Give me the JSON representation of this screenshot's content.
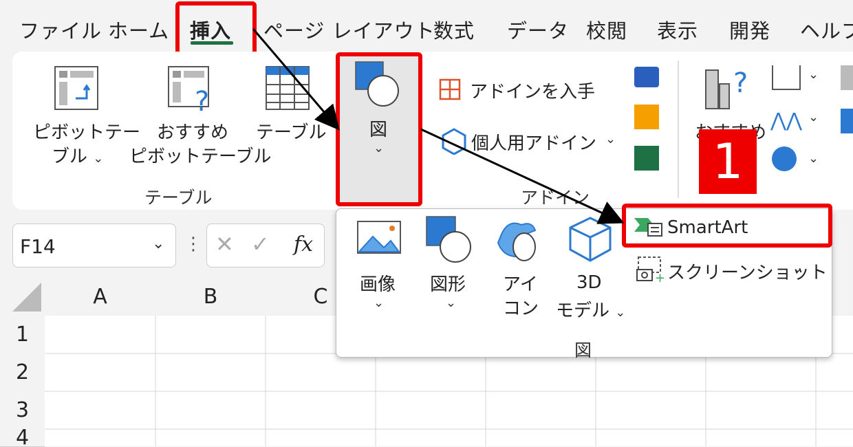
{
  "menu": {
    "tabs": [
      "ファイル",
      "ホーム",
      "挿入",
      "ページ レイアウト",
      "数式",
      "データ",
      "校閲",
      "表示",
      "開発",
      "ヘルプ"
    ]
  },
  "ribbon": {
    "pivot_label_1": "ピボットテー",
    "pivot_label_2": "ブル",
    "rec_pivot_1": "おすすめ",
    "rec_pivot_2": "ピボットテーブル",
    "table_label": "テーブル",
    "group_table": "テーブル",
    "illust_label": "図",
    "get_addins": "アドインを入手",
    "personal_addins": "個人用アドイン",
    "group_addins": "アドイン",
    "rec_charts": "おすすめ"
  },
  "formula_bar": {
    "name_box": "F14",
    "fx": "fx"
  },
  "popup": {
    "picture": "画像",
    "shapes": "図形",
    "icons_1": "アイ",
    "icons_2": "コン",
    "model_1": "3D",
    "model_2": "モデル",
    "smartart": "SmartArt",
    "screenshot": "スクリーンショット",
    "group": "図"
  },
  "badge": "1",
  "grid": {
    "columns": [
      "A",
      "B",
      "C"
    ],
    "rows": [
      "1",
      "2",
      "3",
      "4"
    ]
  },
  "colors": {
    "highlight_red": "#e00000",
    "underline_green": "#1e7145",
    "accent_blue": "#2b79d0"
  }
}
